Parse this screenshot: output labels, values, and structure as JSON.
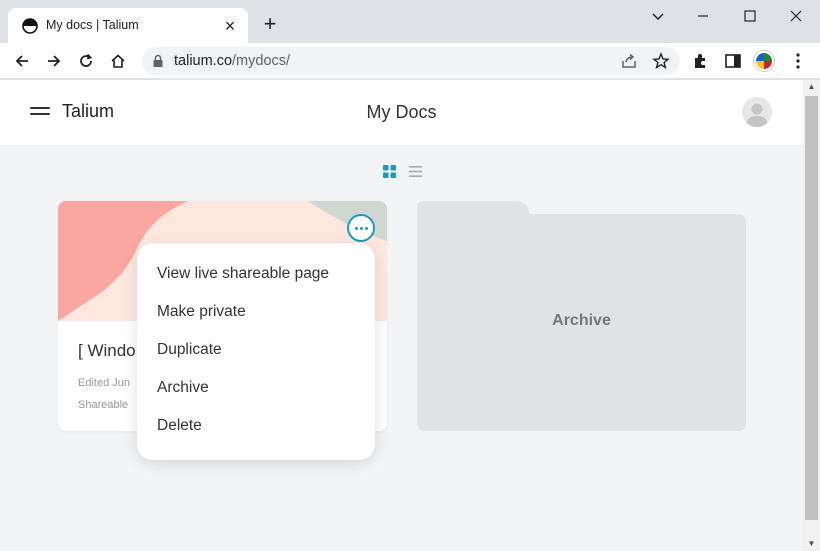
{
  "browser": {
    "tab_title": "My docs | Talium",
    "tab_close": "×",
    "new_tab": "+",
    "url_host": "talium.co",
    "url_path": "/mydocs/"
  },
  "header": {
    "brand": "Talium",
    "title": "My Docs"
  },
  "doc_card": {
    "title": "[ Windo",
    "edited": "Edited Jun",
    "status": "Shareable"
  },
  "archive": {
    "label": "Archive"
  },
  "context_menu": {
    "items": [
      {
        "label": "View live shareable page"
      },
      {
        "label": "Make private"
      },
      {
        "label": "Duplicate"
      },
      {
        "label": "Archive"
      },
      {
        "label": "Delete"
      }
    ]
  },
  "colors": {
    "accent": "#1a9ac0",
    "grid_icon_active": "#1a9ac0",
    "cover_pink": "#f9a7a0",
    "cover_cream": "#fde7df",
    "cover_sage": "#cfd8d0",
    "folder": "#dfe3e6"
  }
}
